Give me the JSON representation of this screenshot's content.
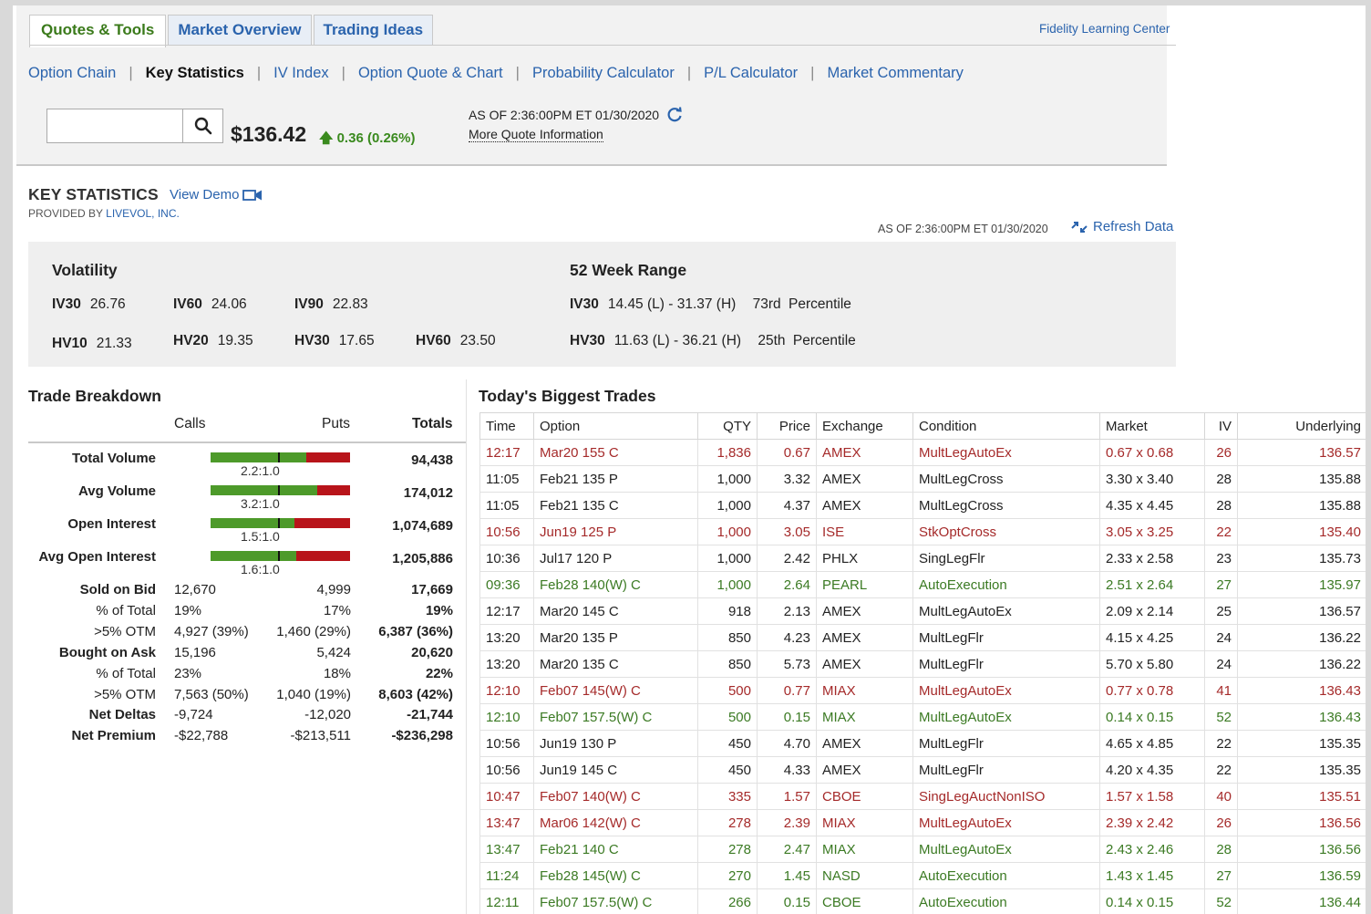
{
  "tabs": [
    "Quotes & Tools",
    "Market Overview",
    "Trading Ideas"
  ],
  "learning_center": "Fidelity Learning Center",
  "subnav": [
    "Option Chain",
    "Key Statistics",
    "IV Index",
    "Option Quote & Chart",
    "Probability Calculator",
    "P/L Calculator",
    "Market Commentary"
  ],
  "quote": {
    "search_value": "",
    "price": "$136.42",
    "change": "0.36 (0.26%)",
    "as_of": "AS OF 2:36:00PM ET 01/30/2020",
    "more_info": "More Quote Information"
  },
  "key_stats": {
    "title": "KEY STATISTICS",
    "view_demo": "View Demo",
    "provided_by": "PROVIDED BY",
    "provider": "LIVEVOL, INC.",
    "as_of": "AS OF 2:36:00PM ET 01/30/2020",
    "refresh": "Refresh Data"
  },
  "volatility": {
    "title": "Volatility",
    "row1": [
      {
        "label": "IV30",
        "value": "26.76"
      },
      {
        "label": "IV60",
        "value": "24.06"
      },
      {
        "label": "IV90",
        "value": "22.83"
      }
    ],
    "row2": [
      {
        "label": "HV10",
        "value": "21.33"
      },
      {
        "label": "HV20",
        "value": "19.35"
      },
      {
        "label": "HV30",
        "value": "17.65"
      },
      {
        "label": "HV60",
        "value": "23.50"
      }
    ]
  },
  "week52": {
    "title": "52 Week Range",
    "rows": [
      {
        "label": "IV30",
        "range": "14.45 (L) - 31.37 (H)",
        "pct": "73rd",
        "pct_label": "Percentile"
      },
      {
        "label": "HV30",
        "range": "11.63 (L) - 36.21 (H)",
        "pct": "25th",
        "pct_label": "Percentile"
      }
    ]
  },
  "trade_breakdown": {
    "title": "Trade Breakdown",
    "headers": {
      "calls": "Calls",
      "puts": "Puts",
      "totals": "Totals"
    },
    "bar_rows": [
      {
        "label": "Total Volume",
        "ratio": "2.2:1.0",
        "total": "94,438",
        "calls_share": 0.688
      },
      {
        "label": "Avg Volume",
        "ratio": "3.2:1.0",
        "total": "174,012",
        "calls_share": 0.762
      },
      {
        "label": "Open Interest",
        "ratio": "1.5:1.0",
        "total": "1,074,689",
        "calls_share": 0.6
      },
      {
        "label": "Avg Open Interest",
        "ratio": "1.6:1.0",
        "total": "1,205,886",
        "calls_share": 0.615
      }
    ],
    "rows": [
      {
        "label": "Sold on Bid",
        "bold": true,
        "calls": "12,670",
        "puts": "4,999",
        "total": "17,669"
      },
      {
        "label": "% of Total",
        "bold": false,
        "calls": "19%",
        "puts": "17%",
        "total": "19%"
      },
      {
        "label": ">5% OTM",
        "bold": false,
        "calls": "4,927 (39%)",
        "puts": "1,460 (29%)",
        "total": "6,387 (36%)"
      },
      {
        "label": "Bought on Ask",
        "bold": true,
        "calls": "15,196",
        "puts": "5,424",
        "total": "20,620"
      },
      {
        "label": "% of Total",
        "bold": false,
        "calls": "23%",
        "puts": "18%",
        "total": "22%"
      },
      {
        "label": ">5% OTM",
        "bold": false,
        "calls": "7,563 (50%)",
        "puts": "1,040 (19%)",
        "total": "8,603 (42%)"
      },
      {
        "label": "Net Deltas",
        "bold": true,
        "calls": "-9,724",
        "puts": "-12,020",
        "total": "-21,744"
      },
      {
        "label": "Net Premium",
        "bold": true,
        "calls": "-$22,788",
        "puts": "-$213,511",
        "total": "-$236,298"
      }
    ]
  },
  "biggest_trades": {
    "title": "Today's Biggest Trades",
    "columns": [
      "Time",
      "Option",
      "QTY",
      "Price",
      "Exchange",
      "Condition",
      "Market",
      "IV",
      "Underlying"
    ],
    "rows": [
      {
        "color": "red",
        "cells": [
          "12:17",
          "Mar20 155 C",
          "1,836",
          "0.67",
          "AMEX",
          "MultLegAutoEx",
          "0.67 x 0.68",
          "26",
          "136.57"
        ]
      },
      {
        "color": "black",
        "cells": [
          "11:05",
          "Feb21 135 P",
          "1,000",
          "3.32",
          "AMEX",
          "MultLegCross",
          "3.30 x 3.40",
          "28",
          "135.88"
        ]
      },
      {
        "color": "black",
        "cells": [
          "11:05",
          "Feb21 135 C",
          "1,000",
          "4.37",
          "AMEX",
          "MultLegCross",
          "4.35 x 4.45",
          "28",
          "135.88"
        ]
      },
      {
        "color": "red",
        "cells": [
          "10:56",
          "Jun19 125 P",
          "1,000",
          "3.05",
          "ISE",
          "StkOptCross",
          "3.05 x 3.25",
          "22",
          "135.40"
        ]
      },
      {
        "color": "black",
        "cells": [
          "10:36",
          "Jul17 120 P",
          "1,000",
          "2.42",
          "PHLX",
          "SingLegFlr",
          "2.33 x 2.58",
          "23",
          "135.73"
        ]
      },
      {
        "color": "green",
        "cells": [
          "09:36",
          "Feb28 140(W) C",
          "1,000",
          "2.64",
          "PEARL",
          "AutoExecution",
          "2.51 x 2.64",
          "27",
          "135.97"
        ]
      },
      {
        "color": "black",
        "cells": [
          "12:17",
          "Mar20 145 C",
          "918",
          "2.13",
          "AMEX",
          "MultLegAutoEx",
          "2.09 x 2.14",
          "25",
          "136.57"
        ]
      },
      {
        "color": "black",
        "cells": [
          "13:20",
          "Mar20 135 P",
          "850",
          "4.23",
          "AMEX",
          "MultLegFlr",
          "4.15 x 4.25",
          "24",
          "136.22"
        ]
      },
      {
        "color": "black",
        "cells": [
          "13:20",
          "Mar20 135 C",
          "850",
          "5.73",
          "AMEX",
          "MultLegFlr",
          "5.70 x 5.80",
          "24",
          "136.22"
        ]
      },
      {
        "color": "red",
        "cells": [
          "12:10",
          "Feb07 145(W) C",
          "500",
          "0.77",
          "MIAX",
          "MultLegAutoEx",
          "0.77 x 0.78",
          "41",
          "136.43"
        ]
      },
      {
        "color": "green",
        "cells": [
          "12:10",
          "Feb07 157.5(W) C",
          "500",
          "0.15",
          "MIAX",
          "MultLegAutoEx",
          "0.14 x 0.15",
          "52",
          "136.43"
        ]
      },
      {
        "color": "black",
        "cells": [
          "10:56",
          "Jun19 130 P",
          "450",
          "4.70",
          "AMEX",
          "MultLegFlr",
          "4.65 x 4.85",
          "22",
          "135.35"
        ]
      },
      {
        "color": "black",
        "cells": [
          "10:56",
          "Jun19 145 C",
          "450",
          "4.33",
          "AMEX",
          "MultLegFlr",
          "4.20 x 4.35",
          "22",
          "135.35"
        ]
      },
      {
        "color": "red",
        "cells": [
          "10:47",
          "Feb07 140(W) C",
          "335",
          "1.57",
          "CBOE",
          "SingLegAuctNonISO",
          "1.57 x 1.58",
          "40",
          "135.51"
        ]
      },
      {
        "color": "red",
        "cells": [
          "13:47",
          "Mar06 142(W) C",
          "278",
          "2.39",
          "MIAX",
          "MultLegAutoEx",
          "2.39 x 2.42",
          "26",
          "136.56"
        ]
      },
      {
        "color": "green",
        "cells": [
          "13:47",
          "Feb21 140 C",
          "278",
          "2.47",
          "MIAX",
          "MultLegAutoEx",
          "2.43 x 2.46",
          "28",
          "136.56"
        ]
      },
      {
        "color": "green",
        "cells": [
          "11:24",
          "Feb28 145(W) C",
          "270",
          "1.45",
          "NASD",
          "AutoExecution",
          "1.43 x 1.45",
          "27",
          "136.59"
        ]
      },
      {
        "color": "green",
        "cells": [
          "12:11",
          "Feb07 157.5(W) C",
          "266",
          "0.15",
          "CBOE",
          "AutoExecution",
          "0.14 x 0.15",
          "52",
          "136.44"
        ]
      }
    ]
  },
  "colors": {
    "link": "#2a63ad",
    "up": "#3a8a1e",
    "red": "#a52a2a",
    "green": "#3b7a23",
    "bar_green": "#4d9a2a",
    "bar_red": "#b8141a"
  }
}
